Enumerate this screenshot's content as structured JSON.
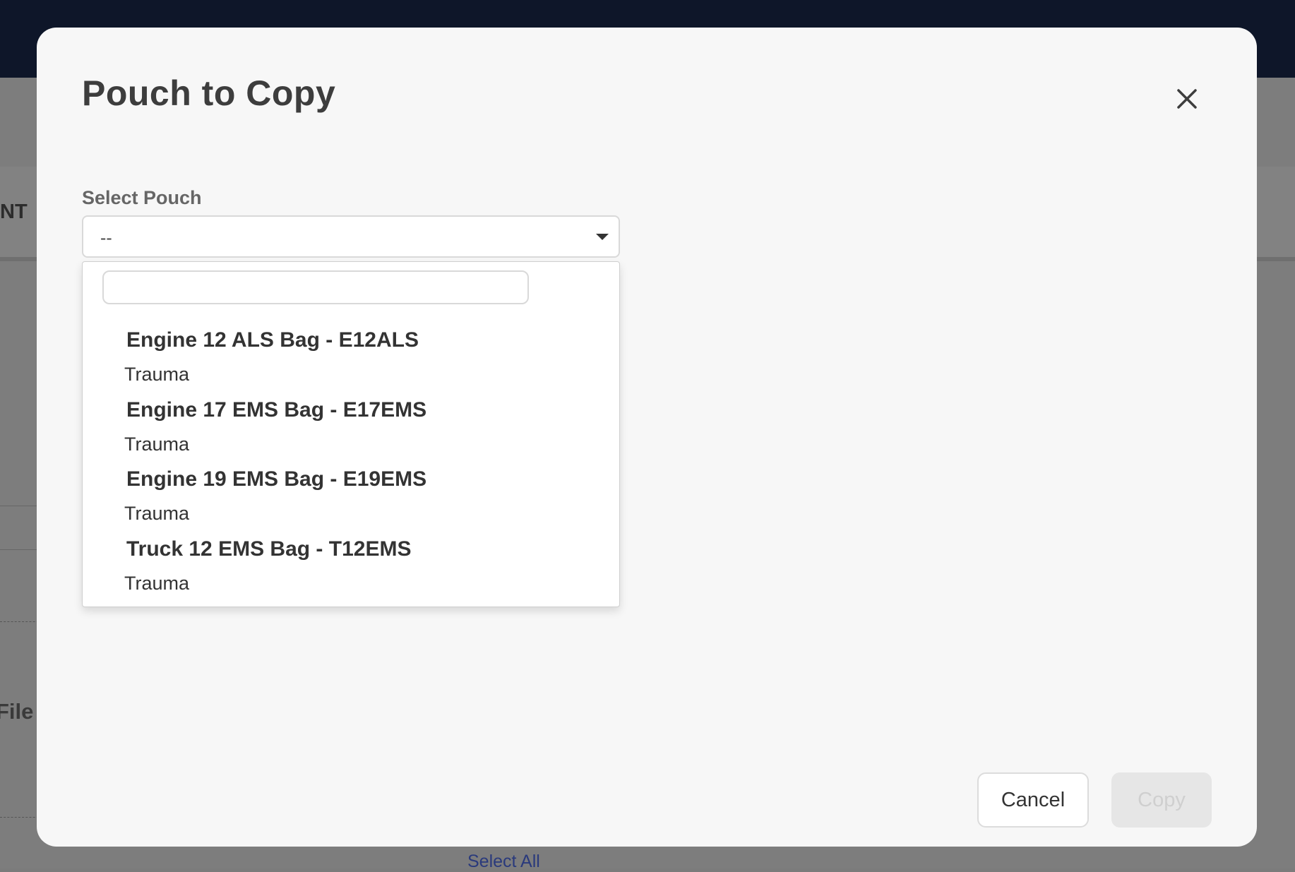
{
  "background": {
    "partial_header_text": "NT",
    "partial_body_text": "File c",
    "select_all_link": "Select All"
  },
  "modal": {
    "title": "Pouch to Copy",
    "close_icon": "close-icon",
    "field_label": "Select Pouch",
    "select_value": "--",
    "search_value": "",
    "groups": [
      {
        "title": "Engine 12 ALS Bag - E12ALS",
        "option": "Trauma"
      },
      {
        "title": "Engine 17 EMS Bag - E17EMS",
        "option": "Trauma"
      },
      {
        "title": "Engine 19 EMS Bag - E19EMS",
        "option": "Trauma"
      },
      {
        "title": "Truck 12 EMS Bag - T12EMS",
        "option": "Trauma"
      }
    ],
    "cancel_label": "Cancel",
    "copy_label": "Copy"
  },
  "colors": {
    "topbar": "#0e1629",
    "modal_bg": "#f7f7f7",
    "disabled_button": "#e6e6e6"
  }
}
